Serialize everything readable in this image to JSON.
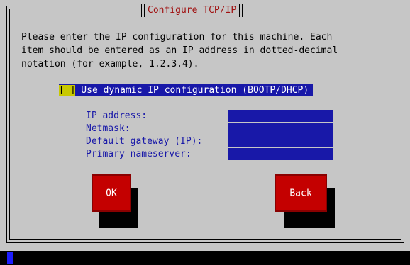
{
  "window": {
    "title": "Configure TCP/IP"
  },
  "description": "Please enter the IP configuration for this machine. Each\nitem should be entered as an IP address in dotted-decimal\nnotation (for example, 1.2.3.4).",
  "dhcp_checkbox": {
    "mark": "[ ]",
    "label": " Use dynamic IP configuration (BOOTP/DHCP)",
    "checked": false
  },
  "fields": [
    {
      "label": "IP address:",
      "value": ""
    },
    {
      "label": "Netmask:",
      "value": ""
    },
    {
      "label": "Default gateway (IP):",
      "value": ""
    },
    {
      "label": "Primary nameserver:",
      "value": ""
    }
  ],
  "buttons": {
    "ok": "OK",
    "back": "Back"
  },
  "colors": {
    "background": "#c6c6c6",
    "accent": "#1818a8",
    "button": "#c40000",
    "title": "#a01010"
  }
}
